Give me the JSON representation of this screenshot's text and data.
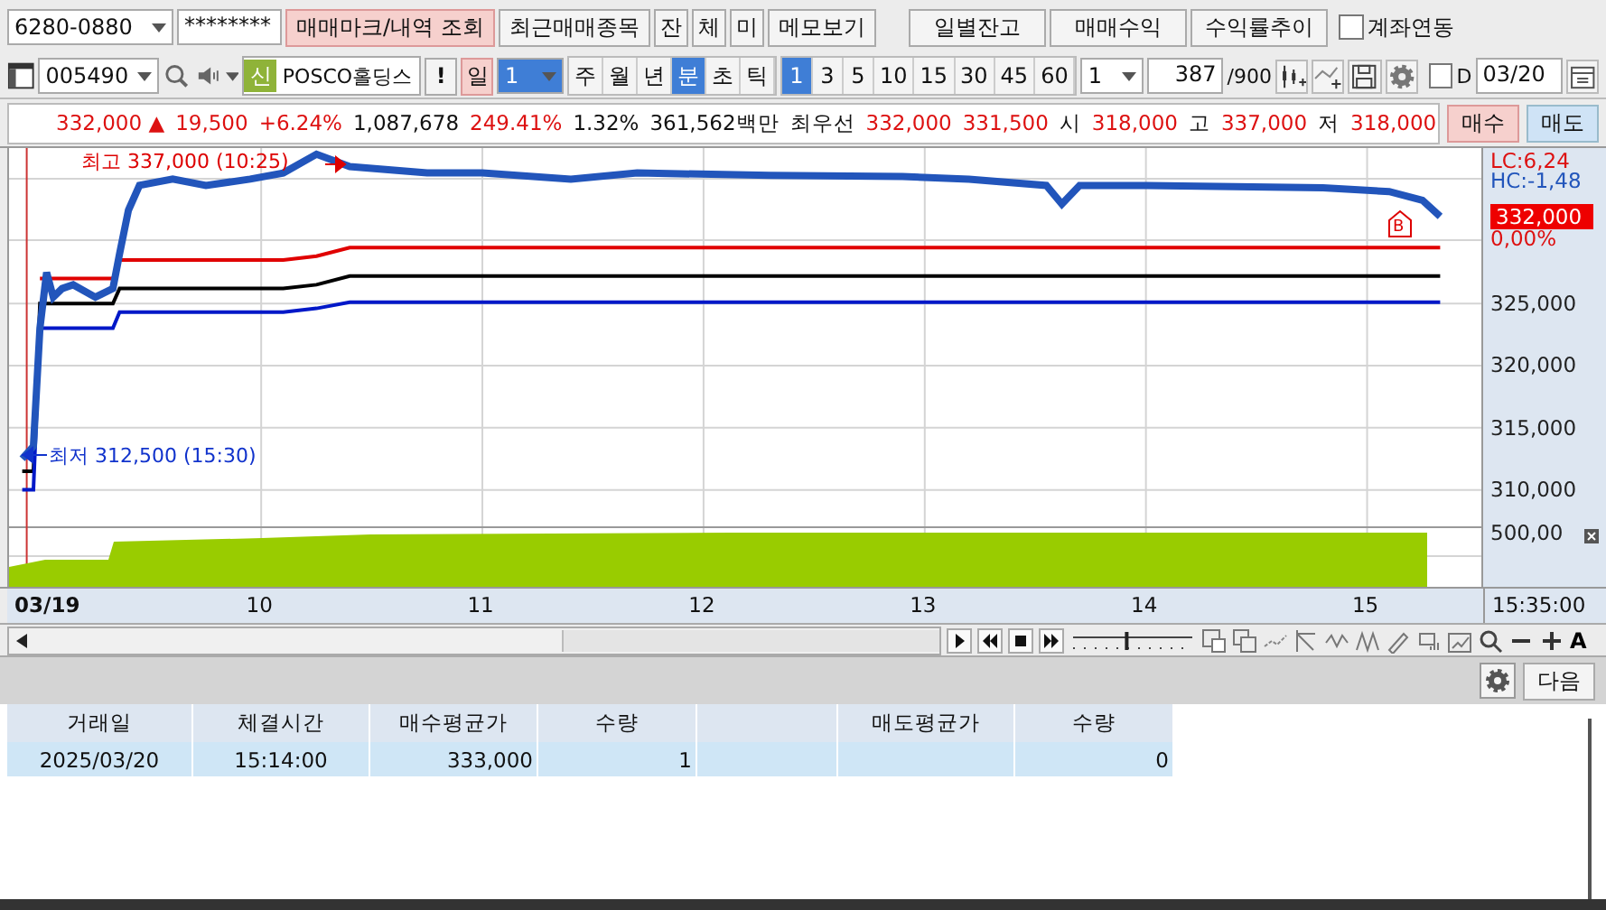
{
  "account": {
    "number": "6280-0880",
    "password": "********"
  },
  "top_buttons": [
    {
      "label": "매매마크/내역 조회",
      "selected": true
    },
    {
      "label": "최근매매종목",
      "selected": false
    },
    {
      "label": "잔",
      "selected": false
    },
    {
      "label": "체",
      "selected": false
    },
    {
      "label": "미",
      "selected": false
    },
    {
      "label": "메모보기",
      "selected": false
    }
  ],
  "right_buttons": [
    "일별잔고",
    "매매수익",
    "수익률추이"
  ],
  "account_link": {
    "label": "계좌연동",
    "checked": false
  },
  "symbol": {
    "code": "005490",
    "badge": "신",
    "name": "POSCO홀딩스"
  },
  "alert_button": "!",
  "day_button": "일",
  "day_count": "1",
  "periods": [
    {
      "label": "주",
      "selected": false
    },
    {
      "label": "월",
      "selected": false
    },
    {
      "label": "년",
      "selected": false
    },
    {
      "label": "분",
      "selected": true
    },
    {
      "label": "초",
      "selected": false
    },
    {
      "label": "틱",
      "selected": false
    }
  ],
  "intervals": [
    {
      "label": "1",
      "selected": true
    },
    {
      "label": "3",
      "selected": false
    },
    {
      "label": "5",
      "selected": false
    },
    {
      "label": "10",
      "selected": false
    },
    {
      "label": "15",
      "selected": false
    },
    {
      "label": "30",
      "selected": false
    },
    {
      "label": "45",
      "selected": false
    },
    {
      "label": "60",
      "selected": false
    }
  ],
  "interval_select": "1",
  "bar_count": {
    "value": "387",
    "max": "/900"
  },
  "d_option": {
    "label": "D",
    "checked": false
  },
  "date": "03/20",
  "quote": {
    "price": "332,000",
    "arrow": "▲",
    "change": "19,500",
    "change_rate": "+6.24%",
    "volume": "1,087,678",
    "volume_rate": "249.41%",
    "turnover": "1.32%",
    "amount": "361,562백만",
    "best_label": "최우선",
    "best_ask": "332,000",
    "best_bid": "331,500",
    "open_label": "시",
    "open": "318,000",
    "high_label": "고",
    "high": "337,000",
    "low_label": "저",
    "low": "318,000"
  },
  "buy_button": "매수",
  "sell_button": "매도",
  "chart": {
    "high_note": "최고 337,000 (10:25)",
    "low_note": "최저 312,500 (15:30)",
    "lc": "LC:6,24",
    "hc": "HC:-1,48",
    "current_price": "332,000",
    "current_rate": "0,00%",
    "buy_mark": "B",
    "date_label": "03/19",
    "volume_label": "500,00",
    "time": "15:35:00",
    "chart_data": {
      "type": "line",
      "x": [
        8.92,
        8.97,
        9.0,
        9.03,
        9.06,
        9.1,
        9.15,
        9.25,
        9.33,
        9.36,
        9.4,
        9.45,
        9.6,
        9.75,
        9.95,
        10.1,
        10.25,
        10.4,
        10.75,
        11.0,
        11.4,
        11.7,
        12.3,
        12.9,
        13.2,
        13.55,
        13.62,
        13.7,
        14.0,
        14.8,
        15.1,
        15.25,
        15.33
      ],
      "series": [
        {
          "color": "#2255bb",
          "values": [
            312500,
            313500,
            323000,
            327500,
            325500,
            326200,
            326500,
            325500,
            326200,
            329000,
            332500,
            334500,
            335000,
            334500,
            335000,
            335500,
            337000,
            336000,
            335500,
            335500,
            335000,
            335500,
            335300,
            335200,
            335000,
            334500,
            333000,
            334500,
            334500,
            334300,
            334000,
            333300,
            332000
          ]
        },
        {
          "color": "#e00000",
          "values": [
            null,
            null,
            327000,
            327000,
            327000,
            327000,
            327000,
            327000,
            327000,
            328500,
            328500,
            328500,
            328500,
            328500,
            328500,
            328500,
            328800,
            329500,
            329500,
            329500,
            329500,
            329500,
            329500,
            329500,
            329500,
            329500,
            329500,
            329500,
            329500,
            329500,
            329500,
            329500,
            329500
          ]
        },
        {
          "color": "#000000",
          "values": [
            311500,
            311500,
            325000,
            325000,
            325000,
            325000,
            325000,
            325000,
            325000,
            326200,
            326200,
            326200,
            326200,
            326200,
            326200,
            326200,
            326500,
            327200,
            327200,
            327200,
            327200,
            327200,
            327200,
            327200,
            327200,
            327200,
            327200,
            327200,
            327200,
            327200,
            327200,
            327200,
            327200
          ]
        },
        {
          "color": "#0018c8",
          "values": [
            310000,
            310000,
            323000,
            323000,
            323000,
            323000,
            323000,
            323000,
            323000,
            324300,
            324300,
            324300,
            324300,
            324300,
            324300,
            324300,
            324600,
            325100,
            325100,
            325100,
            325100,
            325100,
            325100,
            325100,
            325100,
            325100,
            325100,
            325100,
            325100,
            325100,
            325100,
            325100,
            325100
          ]
        }
      ],
      "grid": true,
      "ref_lines": [
        {
          "axis": "x",
          "value": 8.94,
          "color": "#cc3333"
        }
      ],
      "xlim": [
        8.86,
        16.08
      ],
      "ylim": [
        307000,
        337500
      ],
      "xticks": [
        {
          "value": 10,
          "label": "10"
        },
        {
          "value": 11,
          "label": "11"
        },
        {
          "value": 12,
          "label": "12"
        },
        {
          "value": 13,
          "label": "13"
        },
        {
          "value": 14,
          "label": "14"
        },
        {
          "value": 15,
          "label": "15"
        }
      ],
      "yticks": [
        {
          "value": 325000,
          "label": "325,000"
        },
        {
          "value": 320000,
          "label": "320,000"
        },
        {
          "value": 315000,
          "label": "315,000"
        },
        {
          "value": 310000,
          "label": "310,000"
        }
      ]
    }
  },
  "zoom_slider": {
    "level": 0.45
  },
  "font_button": "A",
  "next_button": "다음",
  "table": {
    "columns": [
      {
        "label": "거래일"
      },
      {
        "label": "체결시간"
      },
      {
        "label": "매수평균가"
      },
      {
        "label": "수량"
      },
      {},
      {
        "label": "매도평균가"
      },
      {
        "label": "수량"
      }
    ],
    "rows": [
      [
        "2025/03/20",
        "15:14:00",
        "333,000",
        "1",
        null,
        null,
        "0"
      ]
    ]
  }
}
